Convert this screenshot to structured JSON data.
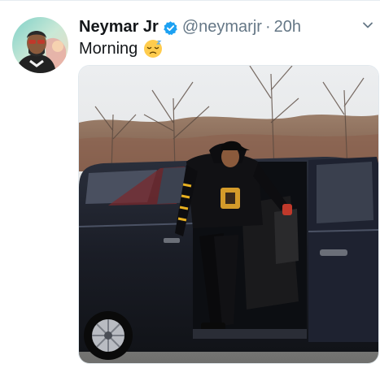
{
  "tweet": {
    "author_name": "Neymar Jr",
    "handle": "@neymarjr",
    "separator": "·",
    "timestamp": "20h",
    "text": "Morning",
    "emoji_icon": "sleepy-face-emoji",
    "verified_icon": "verified-badge-icon",
    "menu_icon": "chevron-down-icon"
  },
  "colors": {
    "name": "#14171a",
    "secondary": "#657786",
    "verified": "#1da1f2",
    "van": "#1b1f2a"
  }
}
